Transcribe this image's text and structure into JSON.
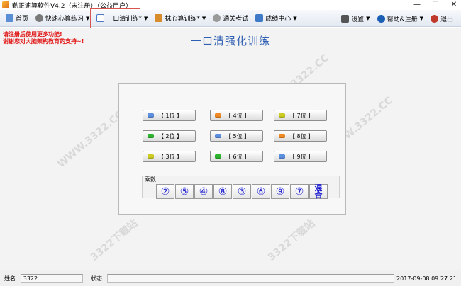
{
  "window": {
    "title": "勤正速算软件V4.2（未注册）（公益用户）",
    "controls": [
      "—",
      "☐",
      "✕"
    ]
  },
  "menu": {
    "items": [
      {
        "label": "首页",
        "icon": "home-icon",
        "color": "#5a8fd6",
        "caret": false
      },
      {
        "label": "快速心算练习",
        "icon": "gear-icon",
        "color": "#7a7a7a",
        "caret": true
      },
      {
        "label": "一口清训练*",
        "icon": "list-icon",
        "color": "#4a76c9",
        "caret": true
      },
      {
        "label": "抹心算训练*",
        "icon": "abacus-icon",
        "color": "#d98c2b",
        "caret": true
      },
      {
        "label": "通关考试",
        "icon": "gear-icon",
        "color": "#9a9a9a",
        "caret": false
      },
      {
        "label": "成绩中心",
        "icon": "chart-icon",
        "color": "#3f7ac8",
        "caret": true
      }
    ],
    "right": [
      {
        "label": "设置",
        "icon": "settings-icon",
        "color": "#555555",
        "caret": true
      },
      {
        "label": "帮助&注册",
        "icon": "help-icon",
        "color": "#1a5fb4",
        "caret": true
      },
      {
        "label": "退出",
        "icon": "exit-icon",
        "color": "#c03a2b",
        "caret": false
      }
    ]
  },
  "notice": {
    "line1": "请注册后使用更多功能!",
    "line2": "谢谢您对大脑架构教育的支持~!"
  },
  "page_title": "一口清强化训练",
  "digit_buttons": [
    {
      "label": "【 1位 】",
      "led": "#5b8fe0"
    },
    {
      "label": "【 2位 】",
      "led": "#2cb52c"
    },
    {
      "label": "【 3位 】",
      "led": "#cccc22"
    },
    {
      "label": "【 4位 】",
      "led": "#f08a24"
    },
    {
      "label": "【 5位 】",
      "led": "#5b8fe0"
    },
    {
      "label": "【 6位 】",
      "led": "#2cb52c"
    },
    {
      "label": "【 7位 】",
      "led": "#cccc22"
    },
    {
      "label": "【 8位 】",
      "led": "#f08a24"
    },
    {
      "label": "【 9位 】",
      "led": "#5b8fe0"
    }
  ],
  "multiplier": {
    "label": "乘数",
    "keys": [
      "②",
      "⑤",
      "④",
      "⑧",
      "③",
      "⑥",
      "⑨",
      "⑦"
    ],
    "mix_line1": "混",
    "mix_line2": "合"
  },
  "watermark_text": "WWW.3322.CC",
  "watermark_text2": "3322下载站",
  "status": {
    "name_label": "姓名:",
    "name_value": "3322",
    "state_label": "状态:",
    "state_value": "",
    "datetime": "2017-09-08 09:27:21"
  }
}
